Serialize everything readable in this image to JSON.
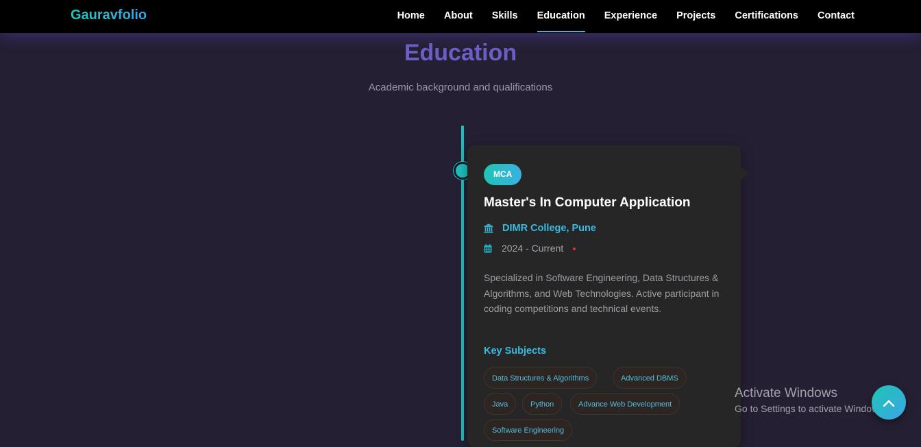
{
  "nav": {
    "brand": "Gauravfolio",
    "links": [
      "Home",
      "About",
      "Skills",
      "Education",
      "Experience",
      "Projects",
      "Certifications",
      "Contact"
    ],
    "active": "Education"
  },
  "section": {
    "title": "Education",
    "subtitle": "Academic background and qualifications"
  },
  "card": {
    "badge": "MCA",
    "title": "Master's In Computer Application",
    "institution": "DIMR College, Pune",
    "institution_icon": "institution-icon",
    "date": "2024 - Current",
    "date_icon": "calendar-icon",
    "description": "Specialized in Software Engineering, Data Structures & Algorithms, and Web Technologies. Active participant in coding competitions and technical events.",
    "subjects_heading": "Key Subjects",
    "subjects": [
      "Data Structures & Algorithms",
      "Advanced DBMS",
      "Java",
      "Python",
      "Advance Web Development",
      "Software Engineering"
    ]
  },
  "watermark": {
    "title": "Activate Windows",
    "subtitle": "Go to Settings to activate Windows."
  },
  "colors": {
    "accent": "#1fbfbf",
    "heading": "#6b5fc4",
    "background": "#251f33",
    "card": "#262626"
  }
}
